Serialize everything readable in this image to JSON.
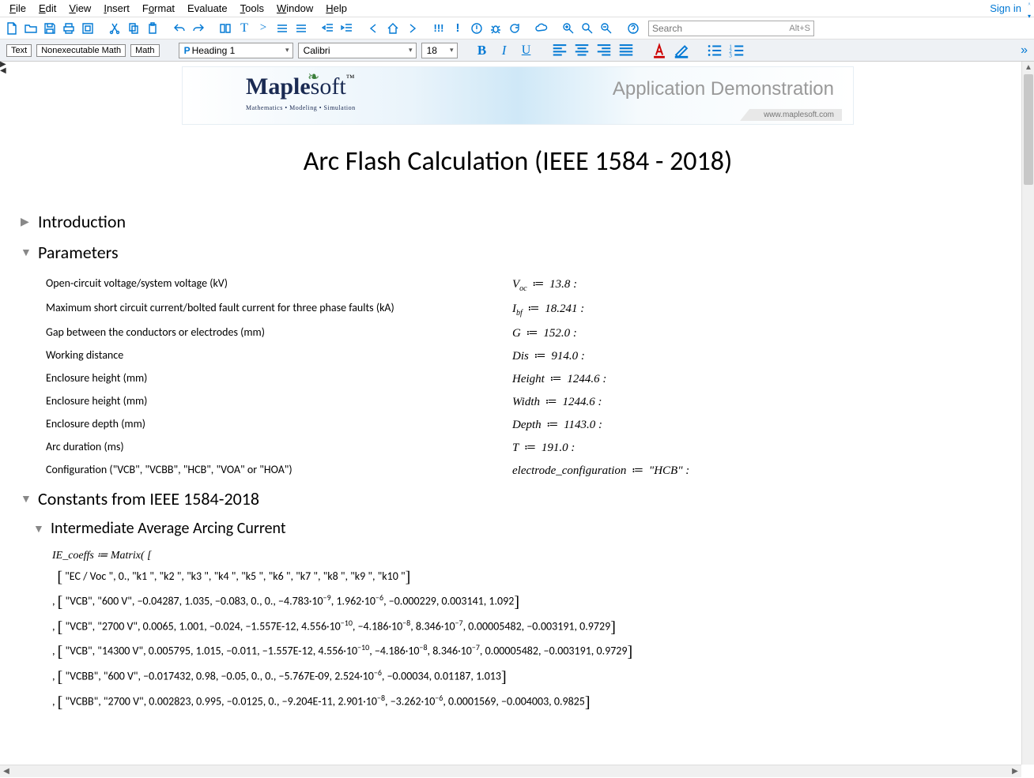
{
  "menus": [
    "File",
    "Edit",
    "View",
    "Insert",
    "Format",
    "Evaluate",
    "Tools",
    "Window",
    "Help"
  ],
  "signin": "Sign in",
  "search_placeholder": "Search",
  "search_hint": "Alt+S",
  "tags": {
    "text": "Text",
    "nonexec": "Nonexecutable Math",
    "math": "Math"
  },
  "para_style": "Heading 1",
  "font_name": "Calibri",
  "font_size": "18",
  "banner": {
    "logo1": "Maple",
    "logo2": "soft",
    "tagline": "Mathematics • Modeling • Simulation",
    "right": "Application Demonstration",
    "site": "www.maplesoft.com"
  },
  "title": "Arc Flash Calculation (IEEE 1584 - 2018)",
  "sections": {
    "intro": "Introduction",
    "params": "Parameters",
    "constants": "Constants from IEEE 1584-2018",
    "subsec": "Intermediate Average Arcing Current"
  },
  "parameters": [
    {
      "label": "Open-circuit voltage/system voltage (kV)",
      "var": "V",
      "sub": "oc",
      "val": "13.8"
    },
    {
      "label": "Maximum short circuit current/bolted fault current for three phase faults (kA)",
      "var": "I",
      "sub": "bf",
      "val": "18.241"
    },
    {
      "label": "Gap between the conductors or electrodes (mm)",
      "var": "G",
      "sub": "",
      "val": "152.0"
    },
    {
      "label": "Working distance",
      "var": "Dis",
      "sub": "",
      "val": "914.0"
    },
    {
      "label": "Enclosure height (mm)",
      "var": "Height",
      "sub": "",
      "val": "1244.6"
    },
    {
      "label": "Enclosure height (mm)",
      "var": "Width",
      "sub": "",
      "val": "1244.6"
    },
    {
      "label": "Enclosure depth (mm)",
      "var": "Depth",
      "sub": "",
      "val": "1143.0"
    },
    {
      "label": "Arc duration (ms)",
      "var": "T",
      "sub": "",
      "val": "191.0"
    },
    {
      "label": "Configuration (\"VCB\", \"VCBB\", \"HCB\", \"VOA\" or \"HOA\")",
      "var": "electrode_configuration",
      "sub": "",
      "val": "\"HCB\""
    }
  ],
  "matrix_head": "IE_coeffs ≔ Matrix",
  "matrix_rows": [
    "\"EC / Voc \", 0., \"k1 \", \"k2 \", \"k3 \", \"k4 \", \"k5 \", \"k6 \", \"k7 \", \"k8 \", \"k9 \", \"k10 \"",
    "\"VCB\", \"600 V\", −0.04287, 1.035, −0.083, 0., 0., −4.783·10<sup class=\"sup\">−9</sup>, 1.962·10<sup class=\"sup\">−6</sup>, −0.000229, 0.003141, 1.092",
    "\"VCB\", \"2700 V\", 0.0065, 1.001, −0.024, −1.557E-12, 4.556·10<sup class=\"sup\">−10</sup>, −4.186·10<sup class=\"sup\">−8</sup>, 8.346·10<sup class=\"sup\">−7</sup>, 0.00005482, −0.003191, 0.9729",
    "\"VCB\", \"14300 V\", 0.005795, 1.015, −0.011, −1.557E-12, 4.556·10<sup class=\"sup\">−10</sup>, −4.186·10<sup class=\"sup\">−8</sup>, 8.346·10<sup class=\"sup\">−7</sup>, 0.00005482, −0.003191, 0.9729",
    "\"VCBB\", \"600 V\", −0.017432, 0.98, −0.05, 0., 0., −5.767E-09, 2.524·10<sup class=\"sup\">−6</sup>, −0.00034, 0.01187, 1.013",
    "\"VCBB\", \"2700 V\", 0.002823, 0.995, −0.0125, 0., −9.204E-11, 2.901·10<sup class=\"sup\">−8</sup>, −3.262·10<sup class=\"sup\">−6</sup>, 0.0001569, −0.004003, 0.9825"
  ]
}
